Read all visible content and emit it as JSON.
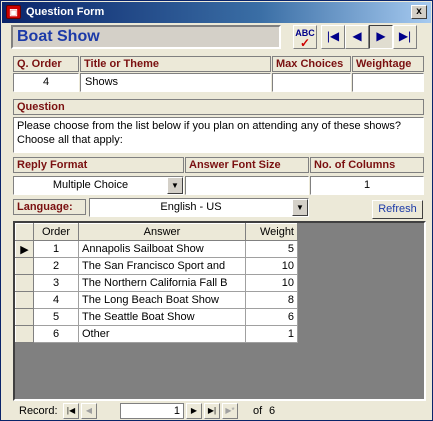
{
  "window": {
    "title": "Question Form",
    "app_icon": "access-form-icon",
    "close_glyph": "x"
  },
  "header": {
    "form_name": "Boat Show"
  },
  "toolbar": {
    "buttons": [
      {
        "name": "spell-check-icon",
        "glyph": "ABC"
      },
      {
        "name": "first-record-icon",
        "glyph": "|◀"
      },
      {
        "name": "previous-record-icon",
        "glyph": "◀"
      },
      {
        "name": "next-record-icon",
        "glyph": "▶"
      },
      {
        "name": "last-record-icon",
        "glyph": "▶|"
      }
    ]
  },
  "fields": {
    "q_order": {
      "label": "Q. Order",
      "value": "4"
    },
    "title_theme": {
      "label": "Title or Theme",
      "value": "Shows"
    },
    "max_choices": {
      "label": "Max Choices",
      "value": ""
    },
    "weightage": {
      "label": "Weightage",
      "value": ""
    },
    "question": {
      "label": "Question",
      "value": "Please choose from the list below if you plan on attending any of these shows? Choose all that apply:"
    },
    "reply_format": {
      "label": "Reply Format",
      "value": "Multiple Choice"
    },
    "answer_font_size": {
      "label": "Answer Font Size",
      "value": ""
    },
    "num_columns": {
      "label": "No. of Columns",
      "value": "1"
    },
    "language": {
      "label": "Language:",
      "value": "English - US"
    }
  },
  "refresh_label": "Refresh",
  "subform": {
    "columns": [
      "Order",
      "Answer",
      "Weight"
    ],
    "rows": [
      {
        "order": "1",
        "answer": "Annapolis Sailboat Show",
        "weight": "5"
      },
      {
        "order": "2",
        "answer": "The San Francisco Sport and",
        "weight": "10"
      },
      {
        "order": "3",
        "answer": "The Northern California Fall B",
        "weight": "10"
      },
      {
        "order": "4",
        "answer": "The Long Beach Boat Show",
        "weight": "8"
      },
      {
        "order": "5",
        "answer": "The Seattle Boat Show",
        "weight": "6"
      },
      {
        "order": "6",
        "answer": "Other",
        "weight": "1"
      }
    ],
    "current_row_marker": "▶"
  },
  "navigator": {
    "label": "Record:",
    "current": "1",
    "of_label": "of",
    "total": "6"
  }
}
